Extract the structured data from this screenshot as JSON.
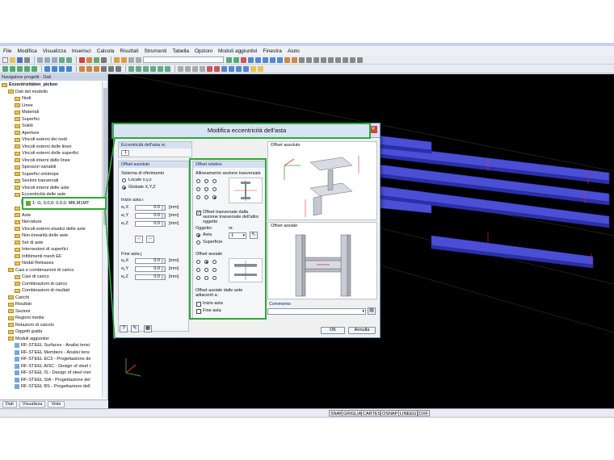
{
  "menu": [
    "File",
    "Modifica",
    "Visualizza",
    "Inserisci",
    "Calcola",
    "Risultati",
    "Strumenti",
    "Tabella",
    "Opzioni",
    "Moduli aggiuntivi",
    "Finestra",
    "Aiuto"
  ],
  "navigator": {
    "title": "Navigatore progetti - Dati",
    "tabs": [
      "Dati",
      "Visualizza",
      "Viste"
    ],
    "items": [
      {
        "label": "Exzentrizitäten_picken",
        "indent": 0,
        "kind": "root",
        "bold": true
      },
      {
        "label": "Dati del modello",
        "indent": 1,
        "kind": "folder"
      },
      {
        "label": "Nodi",
        "indent": 2,
        "kind": "folder"
      },
      {
        "label": "Linee",
        "indent": 2,
        "kind": "folder"
      },
      {
        "label": "Materiali",
        "indent": 2,
        "kind": "folder"
      },
      {
        "label": "Superfici",
        "indent": 2,
        "kind": "folder"
      },
      {
        "label": "Solidi",
        "indent": 2,
        "kind": "folder"
      },
      {
        "label": "Aperture",
        "indent": 2,
        "kind": "folder"
      },
      {
        "label": "Vincoli esterni dei nodi",
        "indent": 2,
        "kind": "folder"
      },
      {
        "label": "Vincoli esterni delle linee",
        "indent": 2,
        "kind": "folder"
      },
      {
        "label": "Vincoli esterni delle superfici",
        "indent": 2,
        "kind": "folder"
      },
      {
        "label": "Vincoli interni delle linee",
        "indent": 2,
        "kind": "folder"
      },
      {
        "label": "Spessori variabili",
        "indent": 2,
        "kind": "folder"
      },
      {
        "label": "Superfici ortotrope",
        "indent": 2,
        "kind": "folder"
      },
      {
        "label": "Sezioni trasversali",
        "indent": 2,
        "kind": "folder"
      },
      {
        "label": "Vincoli interni delle aste",
        "indent": 2,
        "kind": "folder"
      },
      {
        "label": "Eccentricità delle aste",
        "indent": 2,
        "kind": "folder"
      },
      {
        "label": "",
        "indent": 3,
        "kind": "leaf"
      },
      {
        "label": "Divisioni delle aste",
        "indent": 2,
        "kind": "folder"
      },
      {
        "label": "Aste",
        "indent": 2,
        "kind": "folder"
      },
      {
        "label": "Nervature",
        "indent": 2,
        "kind": "folder"
      },
      {
        "label": "Vincoli esterni elastici delle aste",
        "indent": 2,
        "kind": "folder"
      },
      {
        "label": "Non-linearità delle aste",
        "indent": 2,
        "kind": "folder"
      },
      {
        "label": "Set di aste",
        "indent": 2,
        "kind": "folder"
      },
      {
        "label": "Intersezioni di superfici",
        "indent": 2,
        "kind": "folder"
      },
      {
        "label": "Infittimenti mesh EF",
        "indent": 2,
        "kind": "folder"
      },
      {
        "label": "Nodal Releases",
        "indent": 2,
        "kind": "folder"
      },
      {
        "label": "Casi e combinazioni di carico",
        "indent": 1,
        "kind": "folder"
      },
      {
        "label": "Casi di carico",
        "indent": 2,
        "kind": "folder"
      },
      {
        "label": "Combinazioni di carico",
        "indent": 2,
        "kind": "folder"
      },
      {
        "label": "Combinazioni di risultati",
        "indent": 2,
        "kind": "folder"
      },
      {
        "label": "Carichi",
        "indent": 1,
        "kind": "folder"
      },
      {
        "label": "Risultati",
        "indent": 1,
        "kind": "folder"
      },
      {
        "label": "Sezioni",
        "indent": 1,
        "kind": "folder"
      },
      {
        "label": "Regioni medie",
        "indent": 1,
        "kind": "folder"
      },
      {
        "label": "Relazioni di calcolo",
        "indent": 1,
        "kind": "folder"
      },
      {
        "label": "Oggetti guida",
        "indent": 1,
        "kind": "folder"
      },
      {
        "label": "Moduli aggiuntivi",
        "indent": 1,
        "kind": "folder"
      },
      {
        "label": "RF-STEEL Surfaces - Analisi tensi",
        "indent": 2,
        "kind": "module"
      },
      {
        "label": "RF-STEEL Members - Analisi tens",
        "indent": 2,
        "kind": "module"
      },
      {
        "label": "RF-STEEL EC3 - Progettazione de",
        "indent": 2,
        "kind": "module"
      },
      {
        "label": "RF-STEEL AISC - Design of steel r",
        "indent": 2,
        "kind": "module"
      },
      {
        "label": "RF-STEEL IS - Design of steel mer",
        "indent": 2,
        "kind": "module"
      },
      {
        "label": "RF-STEEL SIA - Progettazione del",
        "indent": 2,
        "kind": "module"
      },
      {
        "label": "RF-STEEL BS - Progettazione dell",
        "indent": 2,
        "kind": "module"
      }
    ]
  },
  "callout": {
    "label": "1: G; 0,0,0; 0,0,0; MB,M1MT"
  },
  "statusbar": [
    "SNAP",
    "GRIGLIA",
    "CARTES",
    "OSNAP",
    "LINEEG",
    "DXF"
  ],
  "dialog": {
    "title": "Modifica eccentricità dell'asta",
    "close_icon": "close-icon",
    "ecc_no_label": "Eccentricità dell'asta nr.",
    "ecc_no_value": "1",
    "offset_abs": {
      "title": "Offset assoluto",
      "ref_system_label": "Sistema di riferimento",
      "local_label": "Locale x,y,z",
      "global_label": "Globale X,Y,Z",
      "start_label": "Inizio asta i",
      "end_label": "Fine asta j",
      "start_rows": [
        {
          "label": "eᵢ,X",
          "value": "0.0",
          "unit": "[mm]"
        },
        {
          "label": "eᵢ,Y",
          "value": "0.0",
          "unit": "[mm]"
        },
        {
          "label": "eᵢ,Z",
          "value": "0.0",
          "unit": "[mm]"
        }
      ],
      "end_rows": [
        {
          "label": "eⱼ,X",
          "value": "0.0",
          "unit": "[mm]"
        },
        {
          "label": "eⱼ,Y",
          "value": "0.0",
          "unit": "[mm]"
        },
        {
          "label": "eⱼ,Z",
          "value": "0.0",
          "unit": "[mm]"
        }
      ]
    },
    "offset_rel": {
      "title": "Offset relativo",
      "alignment_label": "Allineamento sezione trasversale",
      "transverse_check_label": "Offset trasversale dalla sezione trasversale dell'altro oggetto",
      "object_label": "Oggetto:",
      "nr_label": "nr.",
      "nr_value": "1",
      "asta_label": "Asta",
      "superficie_label": "Superficie",
      "axial_label": "Offset assiale",
      "adjacent_label": "Offset assiale dalle aste adiacenti a:",
      "inizio_label": "Inizio asta",
      "fine_label": "Fine asta"
    },
    "preview_top_label": "Offset assoluto",
    "preview_bottom_label": "Offset assiale",
    "comment_label": "Commento",
    "ok_label": "OK",
    "cancel_label": "Annulla"
  },
  "colors": {
    "accent_highlight": "#2ea83a",
    "beam": "#4b4fd6",
    "viewport_bg": "#000000"
  }
}
